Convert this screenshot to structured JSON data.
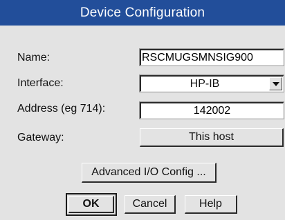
{
  "window": {
    "title": "Device Configuration"
  },
  "fields": {
    "name": {
      "label": "Name:",
      "value": "RSCMUGSMNSIG900"
    },
    "interface": {
      "label": "Interface:",
      "value": "HP-IB"
    },
    "address": {
      "label": "Address (eg 714):",
      "value": "142002"
    },
    "gateway": {
      "label": "Gateway:",
      "value": "This host"
    }
  },
  "buttons": {
    "advanced": "Advanced I/O Config ...",
    "ok": "OK",
    "cancel": "Cancel",
    "help": "Help"
  },
  "icons": {
    "interface_dropdown": "chevron-down-icon"
  },
  "colors": {
    "title_bar": "#224e9a",
    "dialog_bg": "#e3e3e3",
    "field_bg": "#ffffff"
  }
}
